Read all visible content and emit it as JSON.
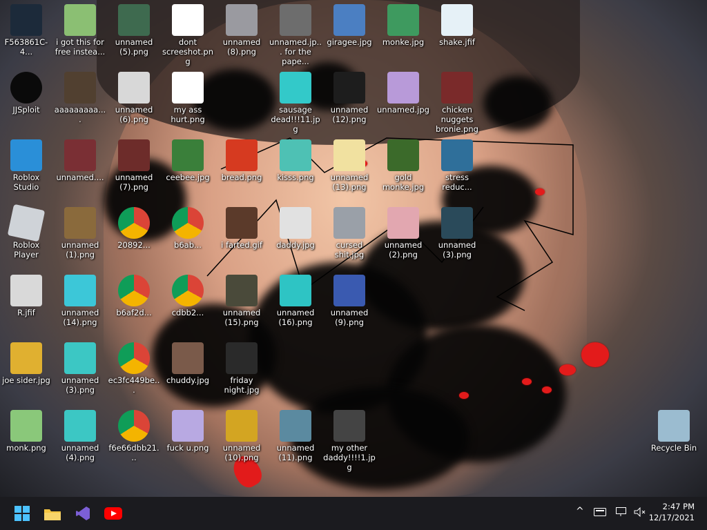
{
  "desktop": {
    "icons": [
      {
        "label": "F563861C-4...",
        "color": "#1c2a3a"
      },
      {
        "label": "i got this for free instea...",
        "color": "#8bbf73"
      },
      {
        "label": "unnamed (5).png",
        "color": "#3e6a4f"
      },
      {
        "label": "dont screeshot.png",
        "color": "#ffffff"
      },
      {
        "label": "unnamed (8).png",
        "color": "#9a9aa0"
      },
      {
        "label": "unnamed.jp... for the pape...",
        "color": "#6d6d6d"
      },
      {
        "label": "giragee.jpg",
        "color": "#4b7fc2"
      },
      {
        "label": "monke.jpg",
        "color": "#3e9a5f"
      },
      {
        "label": "shake.jfif",
        "color": "#e6f1f7"
      },
      {
        "label": "JJSploit",
        "color": "#0a0a0a"
      },
      {
        "label": "aaaaaaaaa....",
        "color": "#514030"
      },
      {
        "label": "unnamed (6).png",
        "color": "#d8d8d8"
      },
      {
        "label": "my ass hurt.png",
        "color": "#ffffff"
      },
      {
        "label": "sausage dead!!!11.jpg",
        "color": "#33c9c9"
      },
      {
        "label": "unnamed (12).png",
        "color": "#1d1d1d"
      },
      {
        "label": "unnamed.jpg",
        "color": "#b89ad9"
      },
      {
        "label": "chicken nuggets bronie.png",
        "color": "#7a2a2a"
      },
      {
        "label": "Roblox Studio",
        "color": "#2a8fd8"
      },
      {
        "label": "unnamed....",
        "color": "#7a2f34"
      },
      {
        "label": "unnamed (7).png",
        "color": "#6d2c2a"
      },
      {
        "label": "ceebee.jpg",
        "color": "#3a7f3a"
      },
      {
        "label": "bread.png",
        "color": "#d63a20"
      },
      {
        "label": "kisss.png",
        "color": "#4ec1b4"
      },
      {
        "label": "unnamed (13).png",
        "color": "#f1e1a0"
      },
      {
        "label": "gold monke.jpg",
        "color": "#3b6a2a"
      },
      {
        "label": "stress reduc...",
        "color": "#2f6f9a"
      },
      {
        "label": "Roblox Player",
        "color": "#cfd3d8"
      },
      {
        "label": "unnamed (1).png",
        "color": "#8a6a3c"
      },
      {
        "label": "20892...",
        "color": "#3a8a3a"
      },
      {
        "label": "b6ab...",
        "color": "#ffffff"
      },
      {
        "label": "i farted.gif",
        "color": "#5b3a2a"
      },
      {
        "label": "daddy.jpg",
        "color": "#e1e1e1"
      },
      {
        "label": "cursed shit.jpg",
        "color": "#9aa0a8"
      },
      {
        "label": "unnamed (2).png",
        "color": "#e2a7b0"
      },
      {
        "label": "unnamed (3).png",
        "color": "#2a4a5a"
      },
      {
        "label": "R.jfif",
        "color": "#d9d9d9"
      },
      {
        "label": "unnamed (14).png",
        "color": "#3cc7d8"
      },
      {
        "label": "b6af2d...",
        "color": "#ffffff"
      },
      {
        "label": "cdbb2...",
        "color": "#ffffff"
      },
      {
        "label": "unnamed (15).png",
        "color": "#4a4a3a"
      },
      {
        "label": "unnamed (16).png",
        "color": "#2ec4c4"
      },
      {
        "label": "unnamed (9).png",
        "color": "#3a5ab0"
      },
      {
        "label": "joe sider.jpg",
        "color": "#e0b030"
      },
      {
        "label": "unnamed (3).png",
        "color": "#3cc7c4"
      },
      {
        "label": "ec3fc449be...",
        "color": "#ffffff"
      },
      {
        "label": "chuddy.jpg",
        "color": "#7a5a4a"
      },
      {
        "label": "friday night.jpg",
        "color": "#2a2a2a"
      },
      {
        "label": "monk.png",
        "color": "#8ac87a"
      },
      {
        "label": "unnamed (4).png",
        "color": "#3cc7c4"
      },
      {
        "label": "f6e66dbb21...",
        "color": "#ffffff"
      },
      {
        "label": "fuck u.png",
        "color": "#b8a9e2"
      },
      {
        "label": "unnamed (10).png",
        "color": "#d3a522"
      },
      {
        "label": "unnamed (11).png",
        "color": "#5b8aa0"
      },
      {
        "label": "my other daddy!!!!1.jpg",
        "color": "#444"
      },
      {
        "label": "Recycle Bin",
        "color": "#9bbcd0"
      }
    ]
  },
  "taskbar": {
    "start_label": "Start",
    "apps": [
      "File Explorer",
      "Visual Studio",
      "YouTube"
    ],
    "time": "2:47 PM",
    "date": "12/17/2021"
  }
}
